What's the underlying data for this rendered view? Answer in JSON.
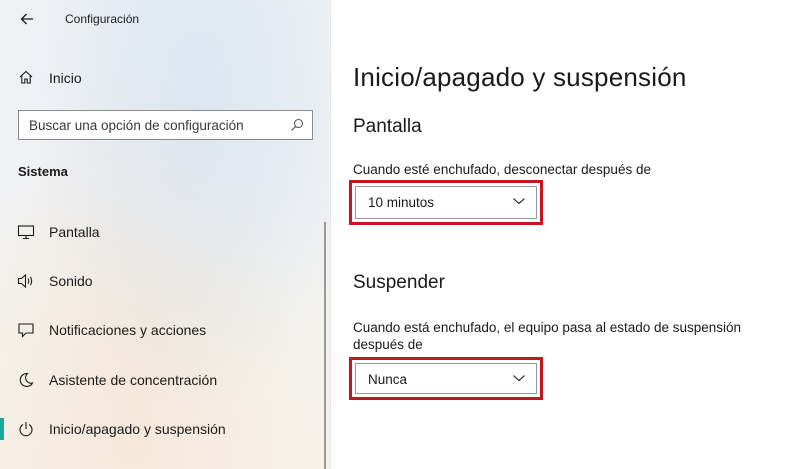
{
  "window": {
    "title": "Configuración"
  },
  "sidebar": {
    "home_label": "Inicio",
    "search_placeholder": "Buscar una opción de configuración",
    "section_heading": "Sistema",
    "items": [
      {
        "label": "Pantalla",
        "icon": "monitor-icon"
      },
      {
        "label": "Sonido",
        "icon": "speaker-icon"
      },
      {
        "label": "Notificaciones y acciones",
        "icon": "notification-icon"
      },
      {
        "label": "Asistente de concentración",
        "icon": "moon-icon"
      },
      {
        "label": "Inicio/apagado y suspensión",
        "icon": "power-icon",
        "active": true
      }
    ],
    "accent_color": "#1aa898"
  },
  "main": {
    "page_title": "Inicio/apagado y suspensión",
    "screen": {
      "heading": "Pantalla",
      "label": "Cuando esté enchufado, desconectar después de",
      "selected": "10 minutos"
    },
    "sleep": {
      "heading": "Suspender",
      "label": "Cuando está enchufado, el equipo pasa al estado de suspensión después de",
      "selected": "Nunca"
    },
    "highlight_color": "#c3161e"
  }
}
